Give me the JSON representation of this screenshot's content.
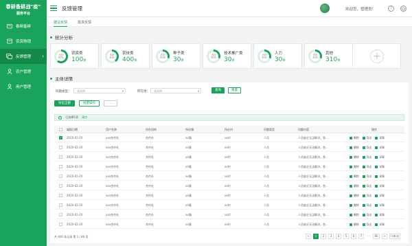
{
  "brand": {
    "title": "春耕备耕战\"疫\"",
    "subtitle": "服务平台"
  },
  "colors": {
    "primary": "#1aa35a",
    "primary_dark": "#138a48",
    "ring_track": "#d9efe2"
  },
  "sidebar": {
    "items": [
      {
        "label": "春耕备耕",
        "icon": "seedling-icon"
      },
      {
        "label": "农资购销",
        "icon": "shop-icon"
      },
      {
        "label": "反馈管理",
        "icon": "feedback-icon",
        "active": true
      },
      {
        "label": "农户管理",
        "icon": "user-group-icon"
      },
      {
        "label": "用户管理",
        "icon": "user-icon"
      }
    ]
  },
  "header": {
    "title": "反馈管理",
    "welcome": "欢迎您，管理员！",
    "help_glyph": "?"
  },
  "tabs": [
    {
      "label": "建议反馈",
      "active": true
    },
    {
      "label": "需求反馈"
    }
  ],
  "stats": {
    "title": "统计分析",
    "cards": [
      {
        "label": "农资类",
        "value": "100",
        "unit": "条",
        "ring_label": "占比",
        "ring_pct": "60%",
        "pct": 60
      },
      {
        "label": "农技类",
        "value": "400",
        "unit": "条",
        "ring_label": "占比",
        "ring_pct": "40%",
        "pct": 40
      },
      {
        "label": "种子类",
        "value": "30",
        "unit": "条",
        "ring_label": "占比",
        "ring_pct": "30%",
        "pct": 30
      },
      {
        "label": "技术推广类",
        "value": "30",
        "unit": "条",
        "ring_label": "占比",
        "ring_pct": "30%",
        "pct": 30
      },
      {
        "label": "人力",
        "value": "30",
        "unit": "条",
        "ring_label": "占比",
        "ring_pct": "30%",
        "pct": 30
      },
      {
        "label": "其他",
        "value": "310",
        "unit": "条",
        "ring_label": "占比",
        "ring_pct": "30%",
        "pct": 30
      }
    ],
    "add_glyph": "+"
  },
  "details": {
    "title": "主体详情",
    "filters": {
      "type_label": "问题类型：",
      "type_placeholder": "请选择",
      "org_label": "所在地：",
      "org_placeholder": "请选择",
      "search_btn": "查询",
      "reset_btn": "重置"
    },
    "actions": {
      "export_all": "导出全部",
      "batch": "批量操作",
      "more": "..."
    },
    "selection": {
      "text": "已选择1项",
      "clear": "清空",
      "info_glyph": "i"
    },
    "columns": [
      "填报日期",
      "用户名称",
      "所在机构",
      "所在镇",
      "所在村",
      "问题类型",
      "问题内容",
      "操作"
    ],
    "row_template": {
      "date": "2020-02-20",
      "user": "xxx合作社",
      "org": "合作社",
      "town": "xx镇",
      "village": "xx村",
      "type": "人员",
      "content": "人员缺乏无法解决，急..."
    },
    "row_count": 10,
    "ops": [
      "删除",
      "导出",
      "详情"
    ],
    "pagination": {
      "total_text": "共 400 条记录 第 1 / 80 页",
      "prev": "<",
      "next": ">",
      "ellipsis": "...",
      "pages": [
        "1",
        "2",
        "3",
        "4",
        "5",
        "6",
        "7"
      ],
      "last": "80",
      "size": "10条/页",
      "jump_label": "跳至",
      "jump_value": "1",
      "jump_unit": "页"
    }
  }
}
